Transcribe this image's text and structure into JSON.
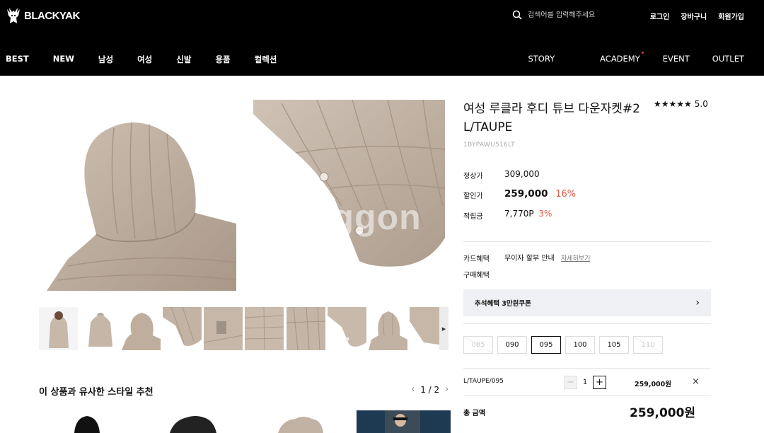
{
  "header": {
    "brand": "BLACKYAK",
    "search_placeholder": "검색어를 입력해주세요",
    "util_links": [
      "로그인",
      "장바구니",
      "회원가입"
    ],
    "nav_left": [
      "BEST",
      "NEW",
      "남성",
      "여성",
      "신발",
      "용품",
      "컬렉션"
    ],
    "nav_right": [
      "STORY",
      "ACADEMY",
      "EVENT",
      "OUTLET"
    ]
  },
  "gallery": {
    "watermark": "nggon"
  },
  "recommend": {
    "title": "이 상품과 유사한 스타일 추천",
    "page": "1 / 2"
  },
  "product": {
    "title": "여성 루클라 후디 튜브 다운자켓#2 L/TAUPE",
    "rating": "5.0",
    "stars": "★★★★★",
    "code": "1BYPAWU516LT",
    "regular_label": "정상가",
    "regular_price": "309,000",
    "sale_label": "할인가",
    "sale_price": "259,000",
    "sale_pct": "16%",
    "points_label": "적립금",
    "points": "7,770P",
    "points_pct": "3%",
    "card_label": "카드혜택",
    "card_value": "무이자 할부 안내",
    "card_link": "자세히보기",
    "purchase_label": "구매혜택",
    "coupon": "추석혜택 3만원쿠폰",
    "sizes": [
      {
        "label": "085",
        "state": "disabled"
      },
      {
        "label": "090",
        "state": "available"
      },
      {
        "label": "095",
        "state": "selected"
      },
      {
        "label": "100",
        "state": "available"
      },
      {
        "label": "105",
        "state": "available"
      },
      {
        "label": "110",
        "state": "disabled"
      }
    ],
    "selected_option": "L/TAUPE/095",
    "quantity": "1",
    "option_price": "259,000원",
    "total_label": "총 금액",
    "total": "259,000원"
  },
  "colors": {
    "header_bg": "#000000",
    "accent_red": "#e05a44",
    "jacket_taupe": "#bfb0a1"
  }
}
